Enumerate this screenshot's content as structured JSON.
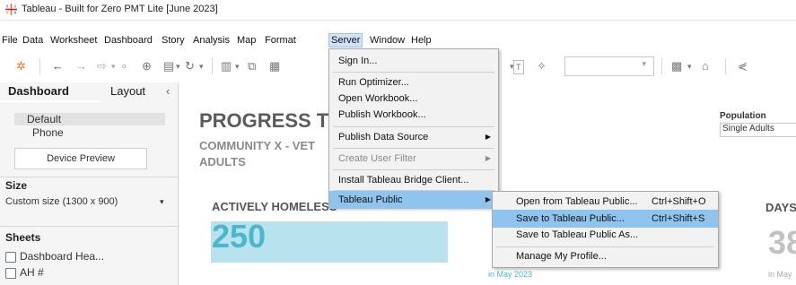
{
  "window": {
    "title": "Tableau - Built for Zero PMT Lite [June 2023]"
  },
  "menubar": [
    "File",
    "Data",
    "Worksheet",
    "Dashboard",
    "Story",
    "Analysis",
    "Map",
    "Format",
    "Server",
    "Window",
    "Help"
  ],
  "server_menu": {
    "items": [
      {
        "label": "Sign In..."
      },
      {
        "label": "Run Optimizer..."
      },
      {
        "label": "Open Workbook..."
      },
      {
        "label": "Publish Workbook..."
      },
      {
        "label": "Publish Data Source"
      },
      {
        "label": "Create User Filter"
      },
      {
        "label": "Install Tableau Bridge Client..."
      },
      {
        "label": "Tableau Public"
      }
    ]
  },
  "tableau_public_menu": {
    "items": [
      {
        "label": "Open from Tableau Public...",
        "shortcut": "Ctrl+Shift+O"
      },
      {
        "label": "Save to Tableau Public...",
        "shortcut": "Ctrl+Shift+S"
      },
      {
        "label": "Save to Tableau Public As..."
      },
      {
        "label": "Manage My Profile..."
      }
    ]
  },
  "left_pane": {
    "tabs": {
      "dashboard": "Dashboard",
      "layout": "Layout"
    },
    "devices": {
      "default": "Default",
      "phone": "Phone"
    },
    "device_preview": "Device Preview",
    "size_heading": "Size",
    "size_value": "Custom size (1300 x 900)",
    "sheets_heading": "Sheets",
    "sheets": [
      "Dashboard Hea...",
      "AH #"
    ]
  },
  "dashboard": {
    "title": "PROGRESS T",
    "subtitle_line1": "COMMUNITY X - VET",
    "subtitle_line2": "ADULTS",
    "kpi_label": "ACTIVELY HOMELESS",
    "kpi_value": "250",
    "footnote": "in May 2023",
    "right_label": "DAYS",
    "right_value": "38",
    "right_footnote": "in May",
    "population_label": "Population",
    "population_value": "Single Adults"
  },
  "colors": {
    "accent_teal": "#4bb7c9",
    "bar_fill": "#b8e2ee",
    "menu_highlight": "#8fc4ee"
  }
}
